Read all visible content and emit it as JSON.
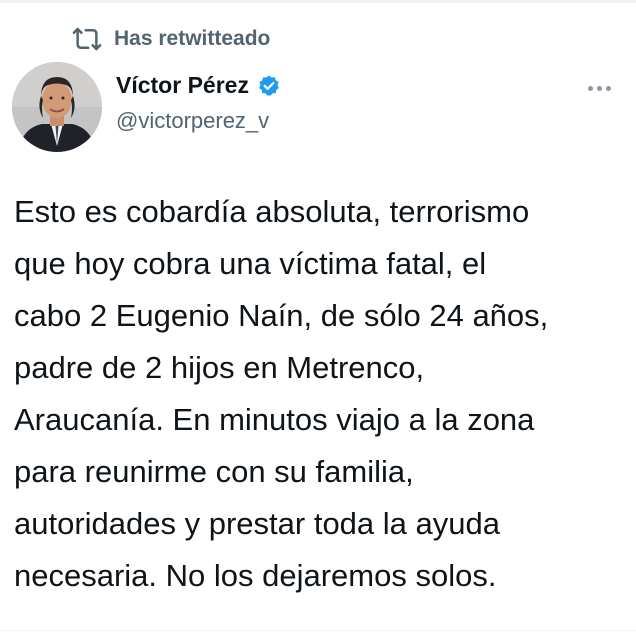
{
  "retweet": {
    "icon": "retweet-icon",
    "label": "Has retwitteado"
  },
  "author": {
    "avatar": "avatar-photo",
    "name": "Víctor Pérez",
    "verified_icon": "verified-badge-icon",
    "verified_color": "#1d9bf0",
    "handle": "@victorperez_v"
  },
  "menu": {
    "icon": "more-options-icon"
  },
  "tweet": {
    "lines": [
      "Esto es cobardía absoluta, terrorismo",
      "que hoy cobra una víctima fatal, el",
      "cabo 2 Eugenio Naín, de sólo 24 años,",
      "padre de 2 hijos en Metrenco,",
      "Araucanía. En minutos viajo a la zona",
      "para reunirme con su familia,",
      "autoridades y prestar toda la ayuda",
      "necesaria. No los dejaremos solos."
    ]
  },
  "colors": {
    "text_primary": "#0f1419",
    "text_secondary": "#536471",
    "accent": "#1d9bf0"
  }
}
